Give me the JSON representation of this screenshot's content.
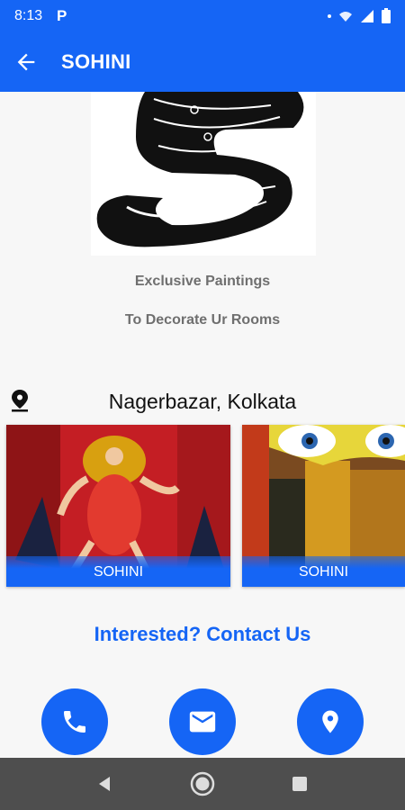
{
  "status_bar": {
    "time": "8:13",
    "app_glyph": "P",
    "icons": [
      "dot",
      "wifi-icon",
      "signal-icon",
      "battery-icon"
    ]
  },
  "app_bar": {
    "title": "SOHINI",
    "back_icon": "arrow-back-icon"
  },
  "logo": {
    "icon": "ornate-s-monogram"
  },
  "taglines": [
    "Exclusive Paintings",
    "To Decorate Ur Rooms"
  ],
  "location": {
    "icon": "location-pin-icon",
    "text": "Nagerbazar, Kolkata"
  },
  "gallery": [
    {
      "label": "SOHINI",
      "image": "painting-durga-dancing"
    },
    {
      "label": "SOHINI",
      "image": "painting-goddess-eyes"
    }
  ],
  "contact": {
    "title": "Interested? Contact Us",
    "buttons": [
      {
        "icon": "phone-icon"
      },
      {
        "icon": "email-icon"
      },
      {
        "icon": "location-pin-icon"
      }
    ]
  },
  "nav_bar": {
    "buttons": [
      "back-triangle-icon",
      "home-circle-icon",
      "recents-square-icon"
    ]
  },
  "colors": {
    "primary": "#1565f5",
    "tagline": "#6f6f6f",
    "nav": "#4e4e4e"
  }
}
